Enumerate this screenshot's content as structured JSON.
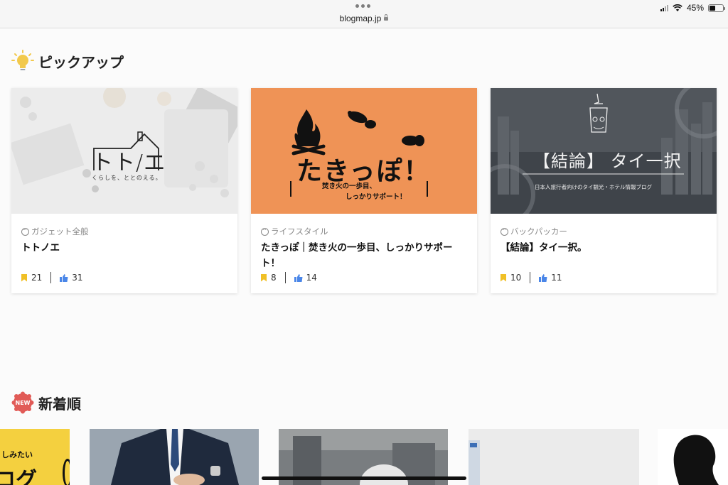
{
  "browser": {
    "url": "blogmap.jp",
    "battery": "45%",
    "battery_level": 0.45
  },
  "pickup": {
    "heading": "ピックアップ",
    "cards": [
      {
        "category": "ガジェット全般",
        "title": "トトノエ",
        "bookmarks": "21",
        "likes": "31",
        "thumb_logo": "トト/エ",
        "thumb_tagline": "くらしを、ととのえる。"
      },
      {
        "category": "ライフスタイル",
        "title": "たきっぽ｜焚き火の一歩目、しっかりサポート！",
        "bookmarks": "8",
        "likes": "14",
        "thumb_logo": "たきっぽ！",
        "thumb_tagline_1": "焚き火の一歩目、",
        "thumb_tagline_2": "しっかりサポート！"
      },
      {
        "category": "バックパッカー",
        "title": "【結論】タイ一択。",
        "bookmarks": "10",
        "likes": "11",
        "thumb_logo": "【結論】 タイ一択",
        "thumb_tagline": "日本人旅行者向けのタイ観光・ホテル情報ブログ"
      }
    ]
  },
  "new_arrivals": {
    "heading": "新着順",
    "badge": "NEW",
    "first_thumb_line1": "しみたい",
    "first_thumb_line2": "ログ"
  },
  "colors": {
    "accent_orange": "#ef9356",
    "bookmark_yellow": "#f0c026",
    "like_blue": "#4a86e8",
    "new_badge_red": "#e15b57"
  }
}
